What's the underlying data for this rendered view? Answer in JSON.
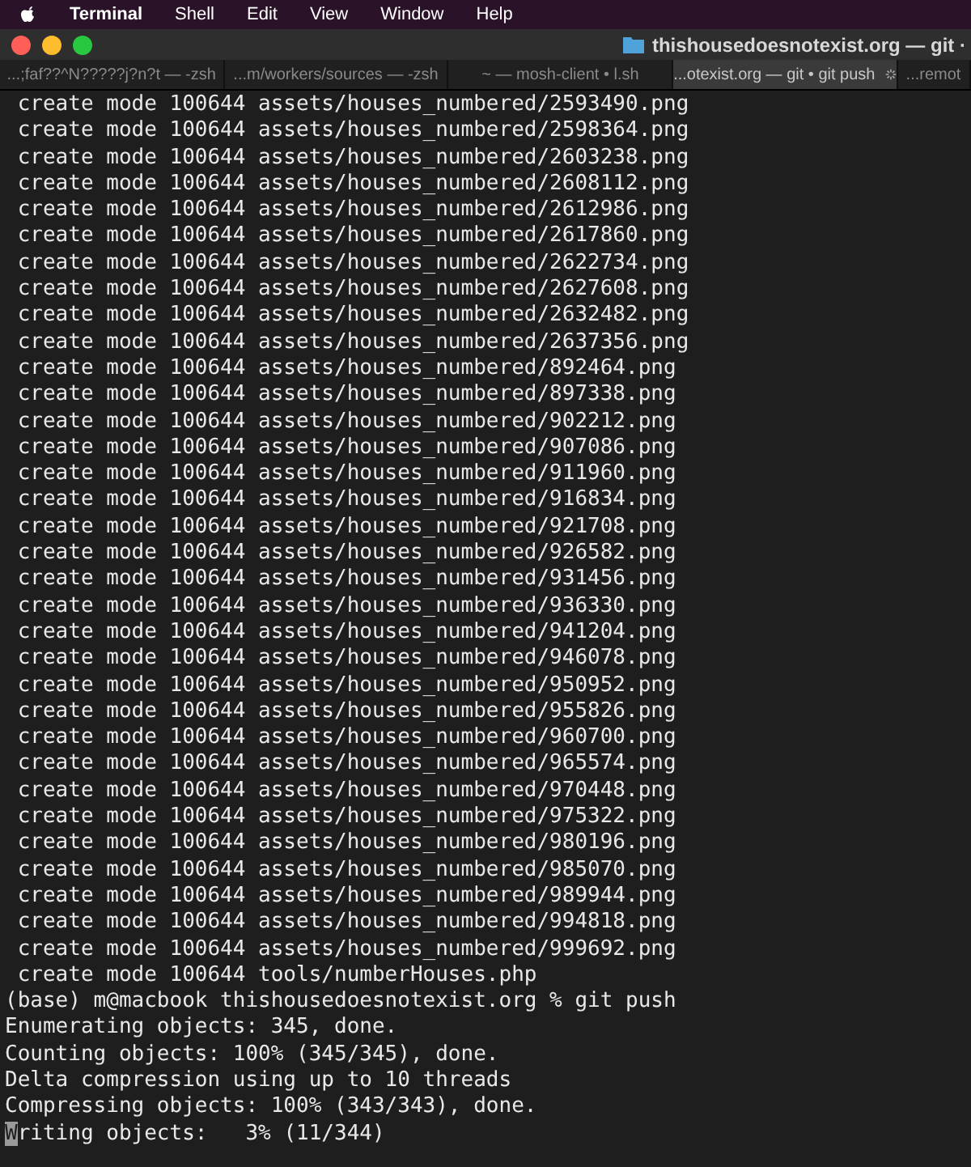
{
  "menu_bar": {
    "app": "Terminal",
    "items": [
      "Shell",
      "Edit",
      "View",
      "Window",
      "Help"
    ]
  },
  "window": {
    "title": "thishousedoesnotexist.org — git ·"
  },
  "tabs": [
    {
      "label": "...;faf??^N?????j?n?t — -zsh",
      "selected": false,
      "busy": false
    },
    {
      "label": "...m/workers/sources — -zsh",
      "selected": false,
      "busy": false
    },
    {
      "label": "~ — mosh-client • l.sh",
      "selected": false,
      "busy": false
    },
    {
      "label": "...otexist.org — git • git push",
      "selected": true,
      "busy": true
    },
    {
      "label": "...remot",
      "selected": false,
      "busy": false
    }
  ],
  "terminal": {
    "lines": [
      {
        "text": " create mode 100644 assets/houses_numbered/2593490.png"
      },
      {
        "text": " create mode 100644 assets/houses_numbered/2598364.png"
      },
      {
        "text": " create mode 100644 assets/houses_numbered/2603238.png"
      },
      {
        "text": " create mode 100644 assets/houses_numbered/2608112.png"
      },
      {
        "text": " create mode 100644 assets/houses_numbered/2612986.png"
      },
      {
        "text": " create mode 100644 assets/houses_numbered/2617860.png"
      },
      {
        "text": " create mode 100644 assets/houses_numbered/2622734.png"
      },
      {
        "text": " create mode 100644 assets/houses_numbered/2627608.png"
      },
      {
        "text": " create mode 100644 assets/houses_numbered/2632482.png"
      },
      {
        "text": " create mode 100644 assets/houses_numbered/2637356.png"
      },
      {
        "text": " create mode 100644 assets/houses_numbered/892464.png"
      },
      {
        "text": " create mode 100644 assets/houses_numbered/897338.png"
      },
      {
        "text": " create mode 100644 assets/houses_numbered/902212.png"
      },
      {
        "text": " create mode 100644 assets/houses_numbered/907086.png"
      },
      {
        "text": " create mode 100644 assets/houses_numbered/911960.png"
      },
      {
        "text": " create mode 100644 assets/houses_numbered/916834.png"
      },
      {
        "text": " create mode 100644 assets/houses_numbered/921708.png"
      },
      {
        "text": " create mode 100644 assets/houses_numbered/926582.png"
      },
      {
        "text": " create mode 100644 assets/houses_numbered/931456.png"
      },
      {
        "text": " create mode 100644 assets/houses_numbered/936330.png"
      },
      {
        "text": " create mode 100644 assets/houses_numbered/941204.png"
      },
      {
        "text": " create mode 100644 assets/houses_numbered/946078.png"
      },
      {
        "text": " create mode 100644 assets/houses_numbered/950952.png"
      },
      {
        "text": " create mode 100644 assets/houses_numbered/955826.png"
      },
      {
        "text": " create mode 100644 assets/houses_numbered/960700.png"
      },
      {
        "text": " create mode 100644 assets/houses_numbered/965574.png"
      },
      {
        "text": " create mode 100644 assets/houses_numbered/970448.png"
      },
      {
        "text": " create mode 100644 assets/houses_numbered/975322.png"
      },
      {
        "text": " create mode 100644 assets/houses_numbered/980196.png"
      },
      {
        "text": " create mode 100644 assets/houses_numbered/985070.png"
      },
      {
        "text": " create mode 100644 assets/houses_numbered/989944.png"
      },
      {
        "text": " create mode 100644 assets/houses_numbered/994818.png"
      },
      {
        "text": " create mode 100644 assets/houses_numbered/999692.png"
      },
      {
        "text": " create mode 100644 tools/numberHouses.php"
      },
      {
        "text": "(base) m@macbook thishousedoesnotexist.org % git push"
      },
      {
        "text": "Enumerating objects: 345, done."
      },
      {
        "text": "Counting objects: 100% (345/345), done."
      },
      {
        "text": "Delta compression using up to 10 threads"
      },
      {
        "text": "Compressing objects: 100% (343/343), done."
      },
      {
        "text": "Writing objects:   3% (11/344)",
        "cursor": true
      }
    ]
  }
}
